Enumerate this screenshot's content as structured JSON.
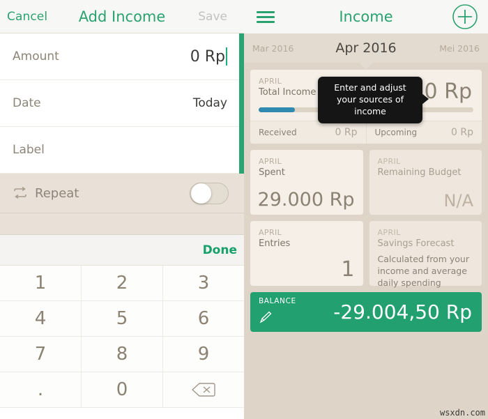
{
  "left": {
    "navbar": {
      "cancel_label": "Cancel",
      "title": "Add Income",
      "save_label": "Save"
    },
    "form_rows": [
      {
        "label": "Amount",
        "value": "0 Rp"
      },
      {
        "label": "Date",
        "value": "Today"
      },
      {
        "label": "Label",
        "value": ""
      }
    ],
    "repeat": {
      "icon": "repeat-icon",
      "label": "Repeat",
      "toggle_state": "off"
    },
    "keyboard": {
      "done_label": "Done",
      "keys": [
        "1",
        "2",
        "3",
        "4",
        "5",
        "6",
        "7",
        "8",
        "9",
        ".",
        "0",
        "backspace-icon"
      ],
      "backspace_glyph": "⌫"
    }
  },
  "right": {
    "navbar": {
      "menu_icon": "hamburger-icon",
      "title": "Income",
      "add_icon": "plus-circle-icon"
    },
    "month_strip": {
      "prev": "Mar 2016",
      "current": "Apr 2016",
      "next": "Mei 2016"
    },
    "income_card": {
      "month": "APRIL",
      "title": "Total Income",
      "amount": "0 Rp",
      "progress_percent": 17,
      "received_label": "Received",
      "received_value": "0 Rp",
      "upcoming_label": "Upcoming",
      "upcoming_value": "0 Rp"
    },
    "cards": [
      {
        "month": "APRIL",
        "title": "Spent",
        "value": "29.000 Rp"
      },
      {
        "month": "APRIL",
        "title": "Remaining Budget",
        "value": "N/A"
      },
      {
        "month": "APRIL",
        "title": "Entries",
        "value": "1"
      },
      {
        "month": "APRIL",
        "title": "Savings Forecast",
        "desc": "Calculated from your income and average daily spending"
      }
    ],
    "balance": {
      "label": "BALANCE",
      "edit_icon": "pencil-icon",
      "value": "-29.004,50 Rp"
    }
  },
  "tooltip": {
    "text": "Enter and adjust your sources of income"
  },
  "watermark": "wsxdn.com",
  "colors": {
    "green": "#22a070",
    "nav_green": "#2aa26f",
    "progress_blue": "#3089ae",
    "card_bg": "#f5efe7",
    "page_bg": "#ded4c8"
  }
}
